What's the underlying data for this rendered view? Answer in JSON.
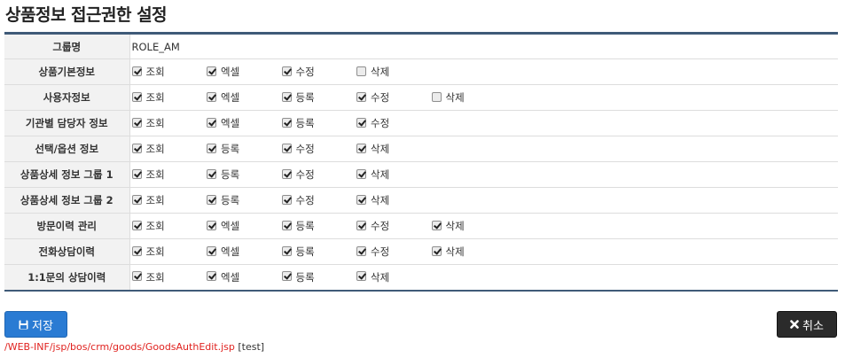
{
  "title": "상품정보 접근권한 설정",
  "group": {
    "label": "그룹명",
    "value": "ROLE_AM"
  },
  "rows": [
    {
      "label": "상품기본정보",
      "perms": [
        {
          "name": "조회",
          "checked": true
        },
        {
          "name": "엑셀",
          "checked": true
        },
        {
          "name": "수정",
          "checked": true
        },
        {
          "name": "삭제",
          "checked": false
        }
      ]
    },
    {
      "label": "사용자정보",
      "perms": [
        {
          "name": "조회",
          "checked": true
        },
        {
          "name": "엑셀",
          "checked": true
        },
        {
          "name": "등록",
          "checked": true
        },
        {
          "name": "수정",
          "checked": true
        },
        {
          "name": "삭제",
          "checked": false
        }
      ]
    },
    {
      "label": "기관별 담당자 정보",
      "perms": [
        {
          "name": "조회",
          "checked": true
        },
        {
          "name": "엑셀",
          "checked": true
        },
        {
          "name": "등록",
          "checked": true
        },
        {
          "name": "수정",
          "checked": true
        }
      ]
    },
    {
      "label": "선택/옵션 정보",
      "perms": [
        {
          "name": "조회",
          "checked": true
        },
        {
          "name": "등록",
          "checked": true
        },
        {
          "name": "수정",
          "checked": true
        },
        {
          "name": "삭제",
          "checked": true
        }
      ]
    },
    {
      "label": "상품상세 정보 그룹 1",
      "perms": [
        {
          "name": "조회",
          "checked": true
        },
        {
          "name": "등록",
          "checked": true
        },
        {
          "name": "수정",
          "checked": true
        },
        {
          "name": "삭제",
          "checked": true
        }
      ]
    },
    {
      "label": "상품상세 정보 그룹 2",
      "perms": [
        {
          "name": "조회",
          "checked": true
        },
        {
          "name": "등록",
          "checked": true
        },
        {
          "name": "수정",
          "checked": true
        },
        {
          "name": "삭제",
          "checked": true
        }
      ]
    },
    {
      "label": "방문이력 관리",
      "perms": [
        {
          "name": "조회",
          "checked": true
        },
        {
          "name": "엑셀",
          "checked": true
        },
        {
          "name": "등록",
          "checked": true
        },
        {
          "name": "수정",
          "checked": true
        },
        {
          "name": "삭제",
          "checked": true
        }
      ]
    },
    {
      "label": "전화상담이력",
      "perms": [
        {
          "name": "조회",
          "checked": true
        },
        {
          "name": "엑셀",
          "checked": true
        },
        {
          "name": "등록",
          "checked": true
        },
        {
          "name": "수정",
          "checked": true
        },
        {
          "name": "삭제",
          "checked": true
        }
      ]
    },
    {
      "label": "1:1문의 상담이력",
      "perms": [
        {
          "name": "조회",
          "checked": true
        },
        {
          "name": "엑셀",
          "checked": true
        },
        {
          "name": "등록",
          "checked": true
        },
        {
          "name": "삭제",
          "checked": true
        }
      ]
    }
  ],
  "buttons": {
    "save_label": "저장",
    "save_icon": "floppy-disk-icon",
    "cancel_label": "취소",
    "cancel_icon": "close-icon"
  },
  "footer": {
    "path": "/WEB-INF/jsp/bos/crm/goods/GoodsAuthEdit.jsp",
    "tag": "[test]"
  },
  "colors": {
    "accent": "#2a7bd3",
    "table_border": "#3f5a78",
    "path": "#e0221f",
    "cancel": "#2b2b2b"
  }
}
